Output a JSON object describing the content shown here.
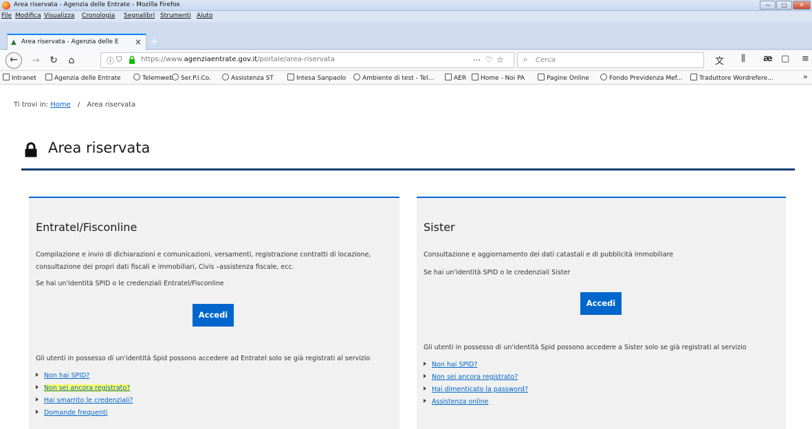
{
  "window": {
    "title": "Area riservata - Agenzia delle Entrate - Mozilla Firefox"
  },
  "menu": [
    "File",
    "Modifica",
    "Visualizza",
    "Cronologia",
    "Segnalibri",
    "Strumenti",
    "Aiuto"
  ],
  "tab": {
    "title": "Area riservata - Agenzia delle E",
    "close": "×",
    "new": "+"
  },
  "nav": {
    "url_prefix": "https://www.",
    "url_domain": "agenziaentrate.gov.it",
    "url_path": "/portale/area-riservata",
    "search_placeholder": "Cerca"
  },
  "bookmarks": [
    "Intranet",
    "Agenzia delle Entrate",
    "Telemweb",
    "Ser.P.I.Co.",
    "Assistenza ST",
    "Intesa Sanpaolo",
    "Ambiente di test - Tel...",
    "AER",
    "Home - Noi PA",
    "Pagine Online",
    "Fondo Previdenza Mef...",
    "Traduttore Wordrefere..."
  ],
  "breadcrumb": {
    "prefix": "Ti trovi in:",
    "home": "Home",
    "sep": "/",
    "current": "Area riservata"
  },
  "page": {
    "title": "Area riservata"
  },
  "left_card": {
    "title": "Entratel/Fisconline",
    "desc1": "Compilazione e invio di dichiarazioni e comunicazioni, versamenti, registrazione contratti di locazione,",
    "desc2": "consultazione dei propri dati fiscali e immobiliari, Civis –assistenza fiscale, ecc.",
    "desc3": "Se hai un'identità SPID o le credenziali Entratel/Fisconline",
    "button": "Accedi",
    "note": "Gli utenti in possesso di un'identità Spid possono accedere ad Entratel solo se già registrati al servizio",
    "links": [
      "Non hai SPID?",
      "Non sei ancora registrato?",
      "Hai smarrito le credenziali?",
      "Domande frequenti"
    ]
  },
  "right_card": {
    "title": "Sister",
    "desc1": "Consultazione e aggiornamento dei dati catastali e di pubblicità immobiliare",
    "desc2": "Se hai un'identità SPID o le credenziali Sister",
    "button": "Accedi",
    "note": "Gli utenti in possesso di un'identità Spid possono accedere a Sister solo se già registrati al servizio",
    "links": [
      "Non hai SPID?",
      "Non sei ancora registrato?",
      "Hai dimenticato la password?",
      "Assistenza online"
    ]
  },
  "colors": {
    "accent": "#0066cc",
    "rule": "#0b3b6e",
    "card_bg": "#f1f1f1",
    "highlight": "#ffff66"
  }
}
